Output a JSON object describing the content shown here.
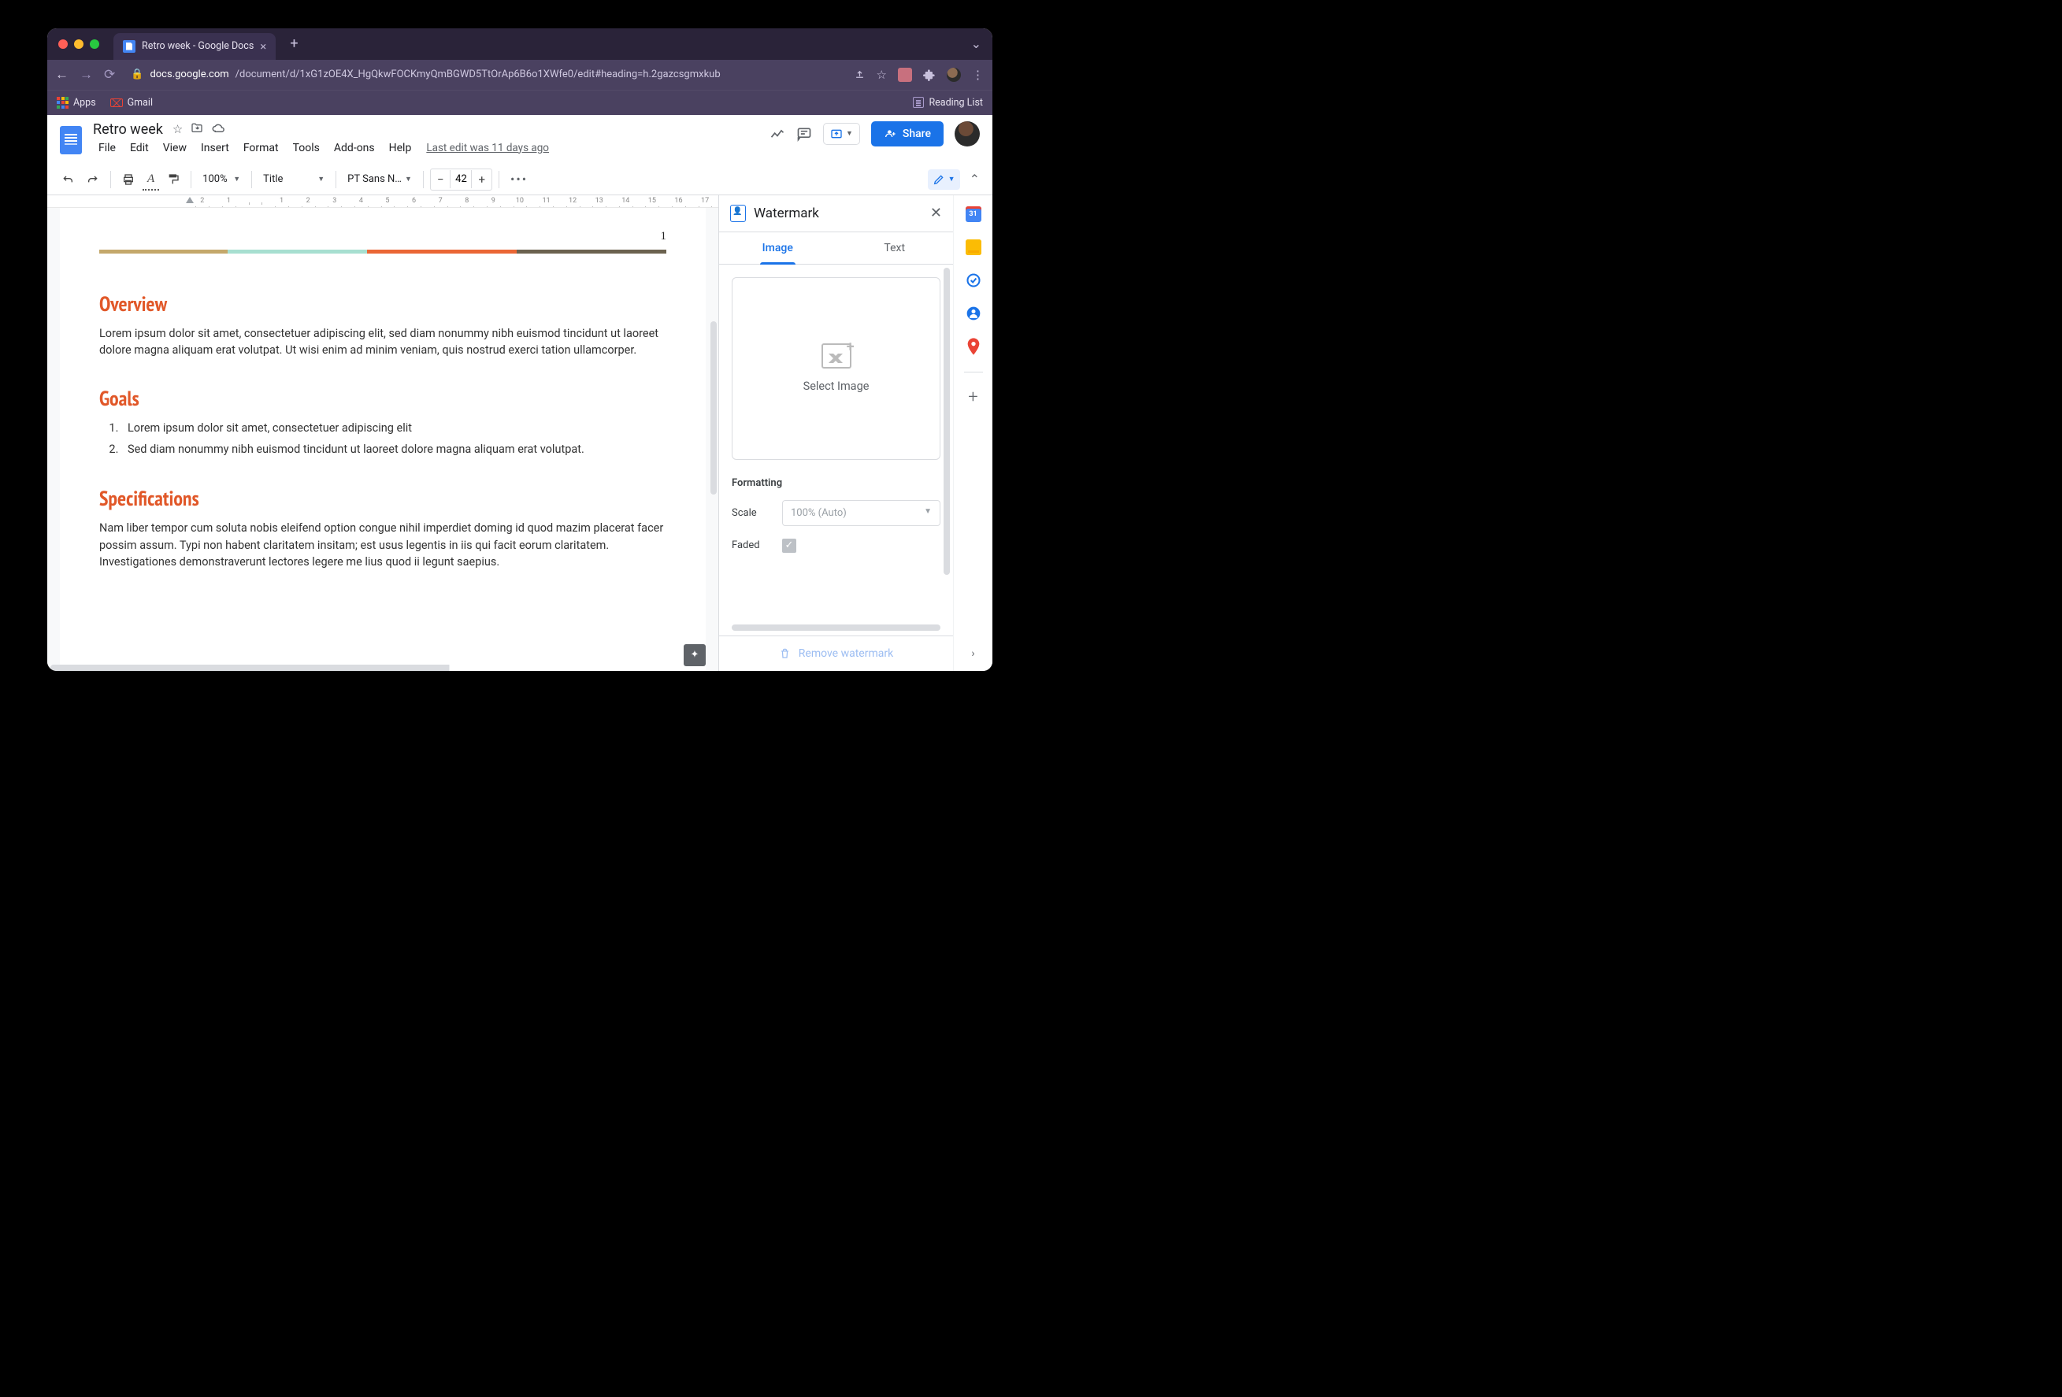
{
  "browser": {
    "tab_title": "Retro week - Google Docs",
    "url_host": "docs.google.com",
    "url_path": "/document/d/1xG1zOE4X_HgQkwFOCKmyQmBGWD5TtOrAp6B6o1XWfe0/edit#heading=h.2gazcsgmxkub",
    "bookmarks": {
      "apps": "Apps",
      "gmail": "Gmail",
      "reading_list": "Reading List"
    }
  },
  "docs": {
    "title": "Retro week",
    "menus": [
      "File",
      "Edit",
      "View",
      "Insert",
      "Format",
      "Tools",
      "Add-ons",
      "Help"
    ],
    "last_edit": "Last edit was 11 days ago",
    "share_label": "Share"
  },
  "toolbar": {
    "zoom": "100%",
    "style": "Title",
    "font": "PT Sans N…",
    "font_size": "42"
  },
  "document": {
    "page_number": "1",
    "h1": "Overview",
    "p1": "Lorem ipsum dolor sit amet, consectetuer adipiscing elit, sed diam nonummy nibh euismod tincidunt ut laoreet dolore magna aliquam erat volutpat. Ut wisi enim ad minim veniam, quis nostrud exerci tation ullamcorper.",
    "h2": "Goals",
    "li1": "Lorem ipsum dolor sit amet, consectetuer adipiscing elit",
    "li2": "Sed diam nonummy nibh euismod tincidunt ut laoreet dolore magna aliquam erat volutpat.",
    "h3": "Specifications",
    "p2": "Nam liber tempor cum soluta nobis eleifend option congue nihil imperdiet doming id quod mazim placerat facer possim assum. Typi non habent claritatem insitam; est usus legentis in iis qui facit eorum claritatem. Investigationes demonstraverunt lectores legere me lius quod ii legunt saepius."
  },
  "panel": {
    "title": "Watermark",
    "tabs": {
      "image": "Image",
      "text": "Text"
    },
    "select_image": "Select Image",
    "formatting_label": "Formatting",
    "scale_label": "Scale",
    "scale_value": "100% (Auto)",
    "faded_label": "Faded",
    "remove_label": "Remove watermark"
  },
  "rail": {
    "cal_day": "31"
  },
  "ruler_marks": [
    "2",
    "1",
    "",
    "1",
    "2",
    "3",
    "4",
    "5",
    "6",
    "7",
    "8",
    "9",
    "10",
    "11",
    "12",
    "13",
    "14",
    "15",
    "16",
    "17"
  ]
}
